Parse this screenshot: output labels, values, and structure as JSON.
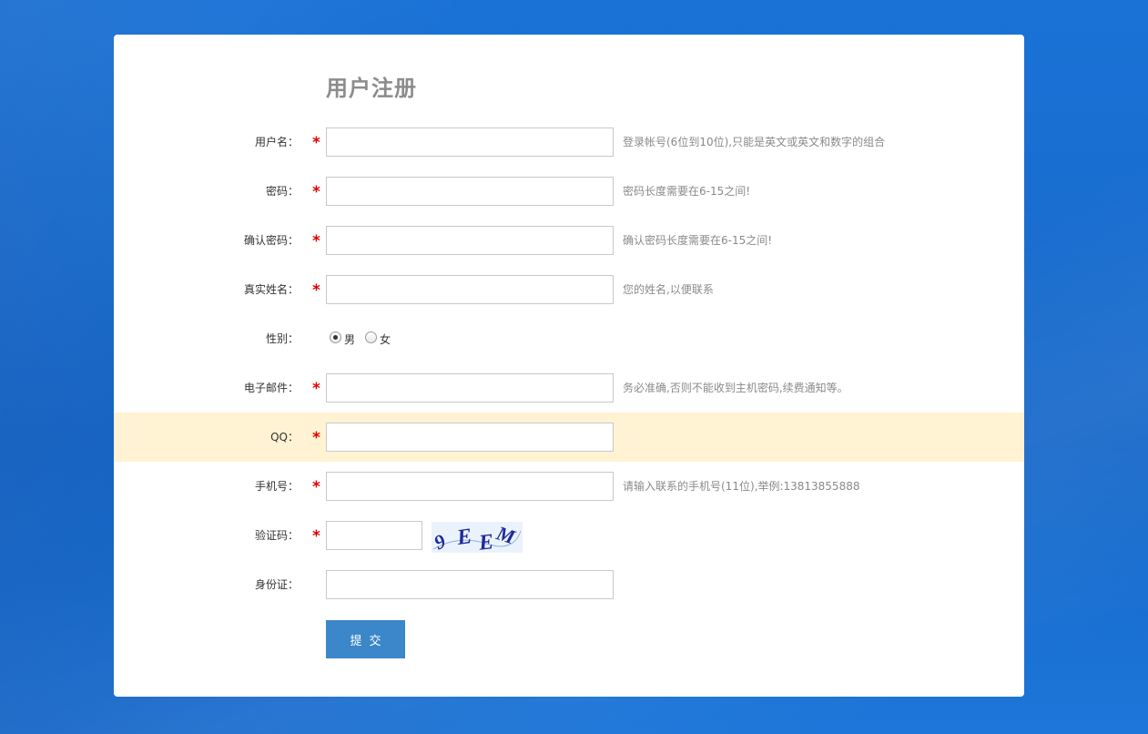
{
  "title": "用户注册",
  "fields": {
    "username": {
      "label": "用户名：",
      "required": "*",
      "value": "",
      "hint": "登录帐号(6位到10位),只能是英文或英文和数字的组合"
    },
    "password": {
      "label": "密码：",
      "required": "*",
      "value": "",
      "hint": "密码长度需要在6-15之间!"
    },
    "confirm_password": {
      "label": "确认密码：",
      "required": "*",
      "value": "",
      "hint": "确认密码长度需要在6-15之间!"
    },
    "real_name": {
      "label": "真实姓名：",
      "required": "*",
      "value": "",
      "hint": "您的姓名,以便联系"
    },
    "gender": {
      "label": "性别：",
      "options": [
        "男",
        "女"
      ],
      "selected": "男"
    },
    "email": {
      "label": "电子邮件：",
      "required": "*",
      "value": "",
      "hint": "务必准确,否则不能收到主机密码,续费通知等。"
    },
    "qq": {
      "label": "QQ：",
      "required": "*",
      "value": ""
    },
    "phone": {
      "label": "手机号：",
      "required": "*",
      "value": "",
      "hint": "请输入联系的手机号(11位),举例:13813855888"
    },
    "captcha": {
      "label": "验证码：",
      "required": "*",
      "value": "",
      "image_text": "9EEM"
    },
    "id_card": {
      "label": "身份证：",
      "value": ""
    }
  },
  "submit_label": "提交",
  "colors": {
    "background": "#1a6fd1",
    "required": "#e00000",
    "highlight_row": "#fff3d3",
    "submit_button": "#3b87c9",
    "captcha_text": "#1f2a9b"
  }
}
